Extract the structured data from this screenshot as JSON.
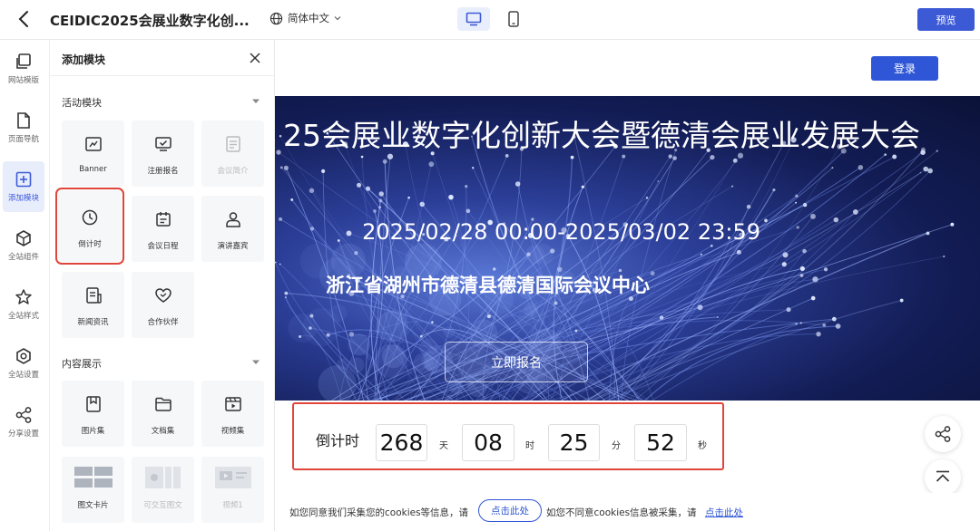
{
  "topbar": {
    "title": "CEIDIC2025会展业数字化创...",
    "language": "简体中文",
    "preview_label": "预览"
  },
  "rail": {
    "items": [
      {
        "label": "网站模版",
        "icon": "template-icon"
      },
      {
        "label": "页面导航",
        "icon": "page-icon"
      },
      {
        "label": "添加模块",
        "icon": "add-module-icon",
        "active": true
      },
      {
        "label": "全站组件",
        "icon": "cube-icon"
      },
      {
        "label": "全站样式",
        "icon": "star-style-icon"
      },
      {
        "label": "全站设置",
        "icon": "hexagon-settings-icon"
      },
      {
        "label": "分享设置",
        "icon": "share-icon"
      }
    ]
  },
  "panel": {
    "title": "添加模块",
    "sections": [
      {
        "title": "活动模块",
        "tiles": [
          {
            "label": "Banner",
            "icon": "banner-icon"
          },
          {
            "label": "注册报名",
            "icon": "register-icon"
          },
          {
            "label": "会议简介",
            "icon": "intro-icon",
            "disabled": true
          },
          {
            "label": "倒计时",
            "icon": "clock-icon",
            "selected": true
          },
          {
            "label": "会议日程",
            "icon": "schedule-icon"
          },
          {
            "label": "演讲嘉宾",
            "icon": "speaker-icon"
          },
          {
            "label": "新闻资讯",
            "icon": "news-icon"
          },
          {
            "label": "合作伙伴",
            "icon": "partner-heart-icon"
          }
        ]
      },
      {
        "title": "内容展示",
        "tiles": [
          {
            "label": "图片集",
            "icon": "image-set-icon"
          },
          {
            "label": "文档集",
            "icon": "folder-icon"
          },
          {
            "label": "视频集",
            "icon": "video-icon"
          },
          {
            "label": "图文卡片",
            "icon": "card-icon"
          },
          {
            "label": "可交互图文",
            "icon": "interactive-icon",
            "disabled": true
          },
          {
            "label": "视频1",
            "icon": "video1-icon",
            "disabled": true
          }
        ]
      }
    ]
  },
  "canvas": {
    "login_label": "登录",
    "banner": {
      "title": "25会展业数字化创新大会暨德清会展业发展大会",
      "date": "2025/02/28 00:00-2025/03/02 23:59",
      "venue": "浙江省湖州市德清县德清国际会议中心",
      "register_label": "立即报名"
    },
    "countdown": {
      "label": "倒计时",
      "days": "268",
      "days_unit": "天",
      "hours": "08",
      "hours_unit": "时",
      "minutes": "25",
      "minutes_unit": "分",
      "seconds": "52",
      "seconds_unit": "秒"
    },
    "cookie": {
      "text1": "如您同意我们采集您的cookies等信息，请",
      "agree_label": "点击此处",
      "text2": "如您不同意cookies信息被采集，请",
      "disagree_label": "点击此处"
    }
  },
  "colors": {
    "accent": "#3c5ad6",
    "highlight": "#e0453a",
    "banner_dark": "#131d56"
  }
}
